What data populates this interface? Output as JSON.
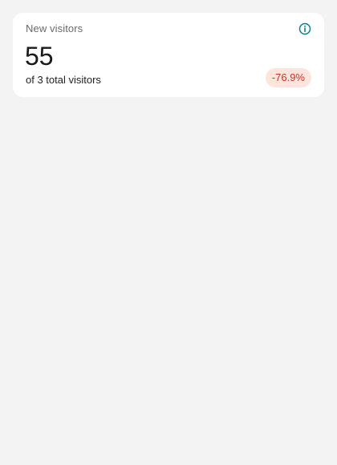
{
  "card": {
    "title": "New visitors",
    "info_icon": "info-circle-icon",
    "value": "55",
    "subtitle": "of 3 total visitors",
    "change": "-76.9%"
  },
  "colors": {
    "accent": "#0a7f86",
    "negative_text": "#c0392b",
    "negative_bg": "#fde4dd",
    "background": "#f3f3f3",
    "card": "#ffffff"
  }
}
